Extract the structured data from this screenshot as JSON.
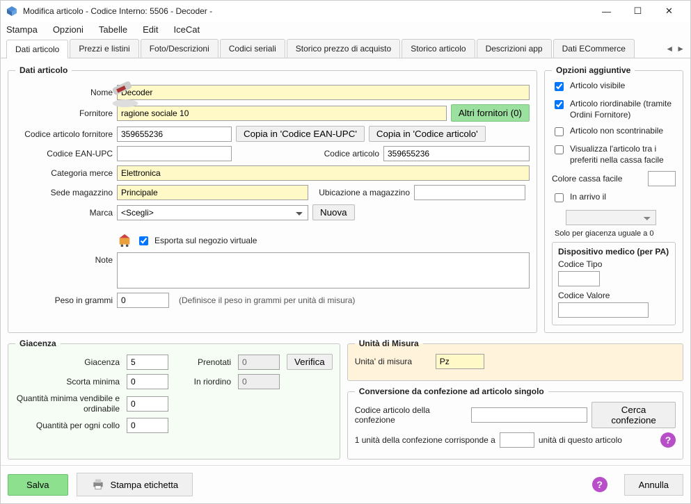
{
  "window": {
    "title": "Modifica articolo - Codice Interno: 5506 - Decoder -"
  },
  "menu": {
    "items": [
      "Stampa",
      "Opzioni",
      "Tabelle",
      "Edit",
      "IceCat"
    ]
  },
  "tabs": {
    "items": [
      "Dati articolo",
      "Prezzi e listini",
      "Foto/Descrizioni",
      "Codici seriali",
      "Storico prezzo di acquisto",
      "Storico articolo",
      "Descrizioni app",
      "Dati ECommerce"
    ],
    "active": 0
  },
  "form": {
    "legend": "Dati articolo",
    "nome_label": "Nome",
    "nome": "Decoder",
    "fornitore_label": "Fornitore",
    "fornitore": "ragione sociale 10",
    "altri_fornitori": "Altri fornitori (0)",
    "cod_forn_label": "Codice articolo fornitore",
    "cod_forn": "359655236",
    "copia_ean": "Copia in 'Codice EAN-UPC'",
    "copia_art": "Copia in 'Codice articolo'",
    "ean_label": "Codice EAN-UPC",
    "ean": "",
    "cod_art_label": "Codice articolo",
    "cod_art": "359655236",
    "categoria_label": "Categoria merce",
    "categoria": "Elettronica",
    "sede_label": "Sede magazzino",
    "sede": "Principale",
    "ubicazione_label": "Ubicazione a magazzino",
    "ubicazione": "",
    "marca_label": "Marca",
    "marca": "<Scegli>",
    "nuova": "Nuova",
    "esporta_label": "Esporta sul negozio virtuale",
    "note_label": "Note",
    "note": "",
    "peso_label": "Peso in grammi",
    "peso": "0",
    "peso_hint": "(Definisce il peso in grammi per unità di misura)"
  },
  "opzioni": {
    "legend": "Opzioni aggiuntive",
    "visibile": "Articolo visibile",
    "riordinabile": "Articolo riordinabile (tramite Ordini Fornitore)",
    "non_scontrinabile": "Articolo non scontrinabile",
    "preferiti": "Visualizza l'articolo tra i preferiti nella cassa facile",
    "colore_label": "Colore cassa facile",
    "in_arrivo": "In arrivo il",
    "in_arrivo_hint": "Solo per giacenza uguale a 0",
    "devmed_legend": "Dispositivo medico (per PA)",
    "devmed_tipo": "Codice Tipo",
    "devmed_valore": "Codice Valore"
  },
  "giacenza": {
    "legend": "Giacenza",
    "giacenza_label": "Giacenza",
    "giacenza": "5",
    "prenotati_label": "Prenotati",
    "prenotati": "0",
    "verifica": "Verifica",
    "scorta_label": "Scorta minima",
    "scorta": "0",
    "riordino_label": "In riordino",
    "riordino": "0",
    "qmin_label": "Quantità minima vendibile e ordinabile",
    "qmin": "0",
    "collo_label": "Quantità per ogni collo",
    "collo": "0"
  },
  "um": {
    "legend": "Unità di Misura",
    "label": "Unita' di misura",
    "value": "Pz"
  },
  "conv": {
    "legend": "Conversione da confezione ad articolo singolo",
    "codice_label": "Codice articolo della confezione",
    "cerca": "Cerca confezione",
    "line1": "1 unità della confezione corrisponde a",
    "line2": "unità di questo articolo"
  },
  "footer": {
    "salva": "Salva",
    "stampa": "Stampa etichetta",
    "annulla": "Annulla"
  }
}
